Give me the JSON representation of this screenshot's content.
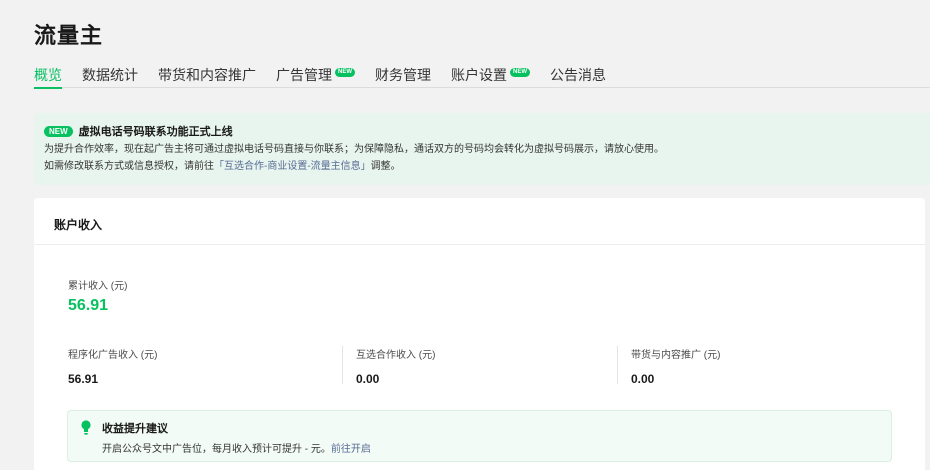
{
  "page_title": "流量主",
  "tabs": [
    {
      "label": "概览",
      "active": true,
      "badge": ""
    },
    {
      "label": "数据统计",
      "active": false,
      "badge": ""
    },
    {
      "label": "带货和内容推广",
      "active": false,
      "badge": ""
    },
    {
      "label": "广告管理",
      "active": false,
      "badge": "NEW"
    },
    {
      "label": "财务管理",
      "active": false,
      "badge": ""
    },
    {
      "label": "账户设置",
      "active": false,
      "badge": "NEW"
    },
    {
      "label": "公告消息",
      "active": false,
      "badge": ""
    }
  ],
  "notice": {
    "badge": "NEW",
    "title": "虚拟电话号码联系功能正式上线",
    "line1": "为提升合作效率，现在起广告主将可通过虚拟电话号码直接与你联系；为保障隐私，通话双方的号码均会转化为虚拟号码展示，请放心使用。",
    "line2_prefix": "如需修改联系方式或信息授权，请前往",
    "line2_link": "「互选合作-商业设置-流量主信息」",
    "line2_suffix": "调整。"
  },
  "income": {
    "title": "账户收入",
    "total_label": "累计收入 (元)",
    "total_value": "56.91",
    "metrics": [
      {
        "label": "程序化广告收入 (元)",
        "value": "56.91"
      },
      {
        "label": "互选合作收入 (元)",
        "value": "0.00"
      },
      {
        "label": "带货与内容推广 (元)",
        "value": "0.00"
      }
    ]
  },
  "tip": {
    "title": "收益提升建议",
    "text": "开启公众号文中广告位，每月收入预计可提升 - 元。",
    "link": "前往开启"
  },
  "colors": {
    "accent": "#07c160",
    "link": "#576b95",
    "notice_bg": "#e8f5ee"
  },
  "icons": {
    "tip_icon": "lightbulb-icon"
  }
}
